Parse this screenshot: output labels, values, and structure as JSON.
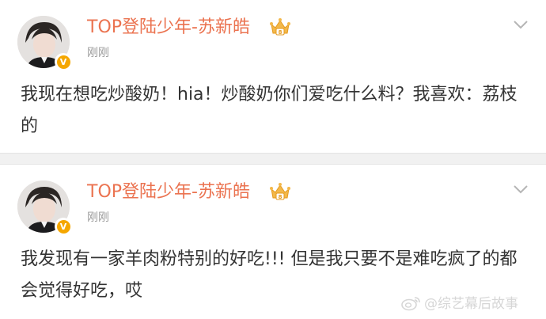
{
  "posts": [
    {
      "username": "TOP登陆少年-苏新皓",
      "timestamp": "刚刚",
      "content": "我现在想吃炒酸奶！hia！炒酸奶你们爱吃什么料？我喜欢：荔枝的",
      "verified_badge": "V",
      "member_icon": "crown-icon"
    },
    {
      "username": "TOP登陆少年-苏新皓",
      "timestamp": "刚刚",
      "content": "我发现有一家羊肉粉特别的好吃!!! 但是我只要不是难吃疯了的都会觉得好吃，哎",
      "verified_badge": "V",
      "member_icon": "crown-icon"
    }
  ],
  "watermark": {
    "text": "@综艺幕后故事",
    "icon": "weibo-logo-icon"
  },
  "colors": {
    "username": "#eb7350",
    "body_text": "#333333",
    "timestamp": "#9a9a9a",
    "verified": "#f5a700",
    "divider": "#f1f1f1"
  }
}
